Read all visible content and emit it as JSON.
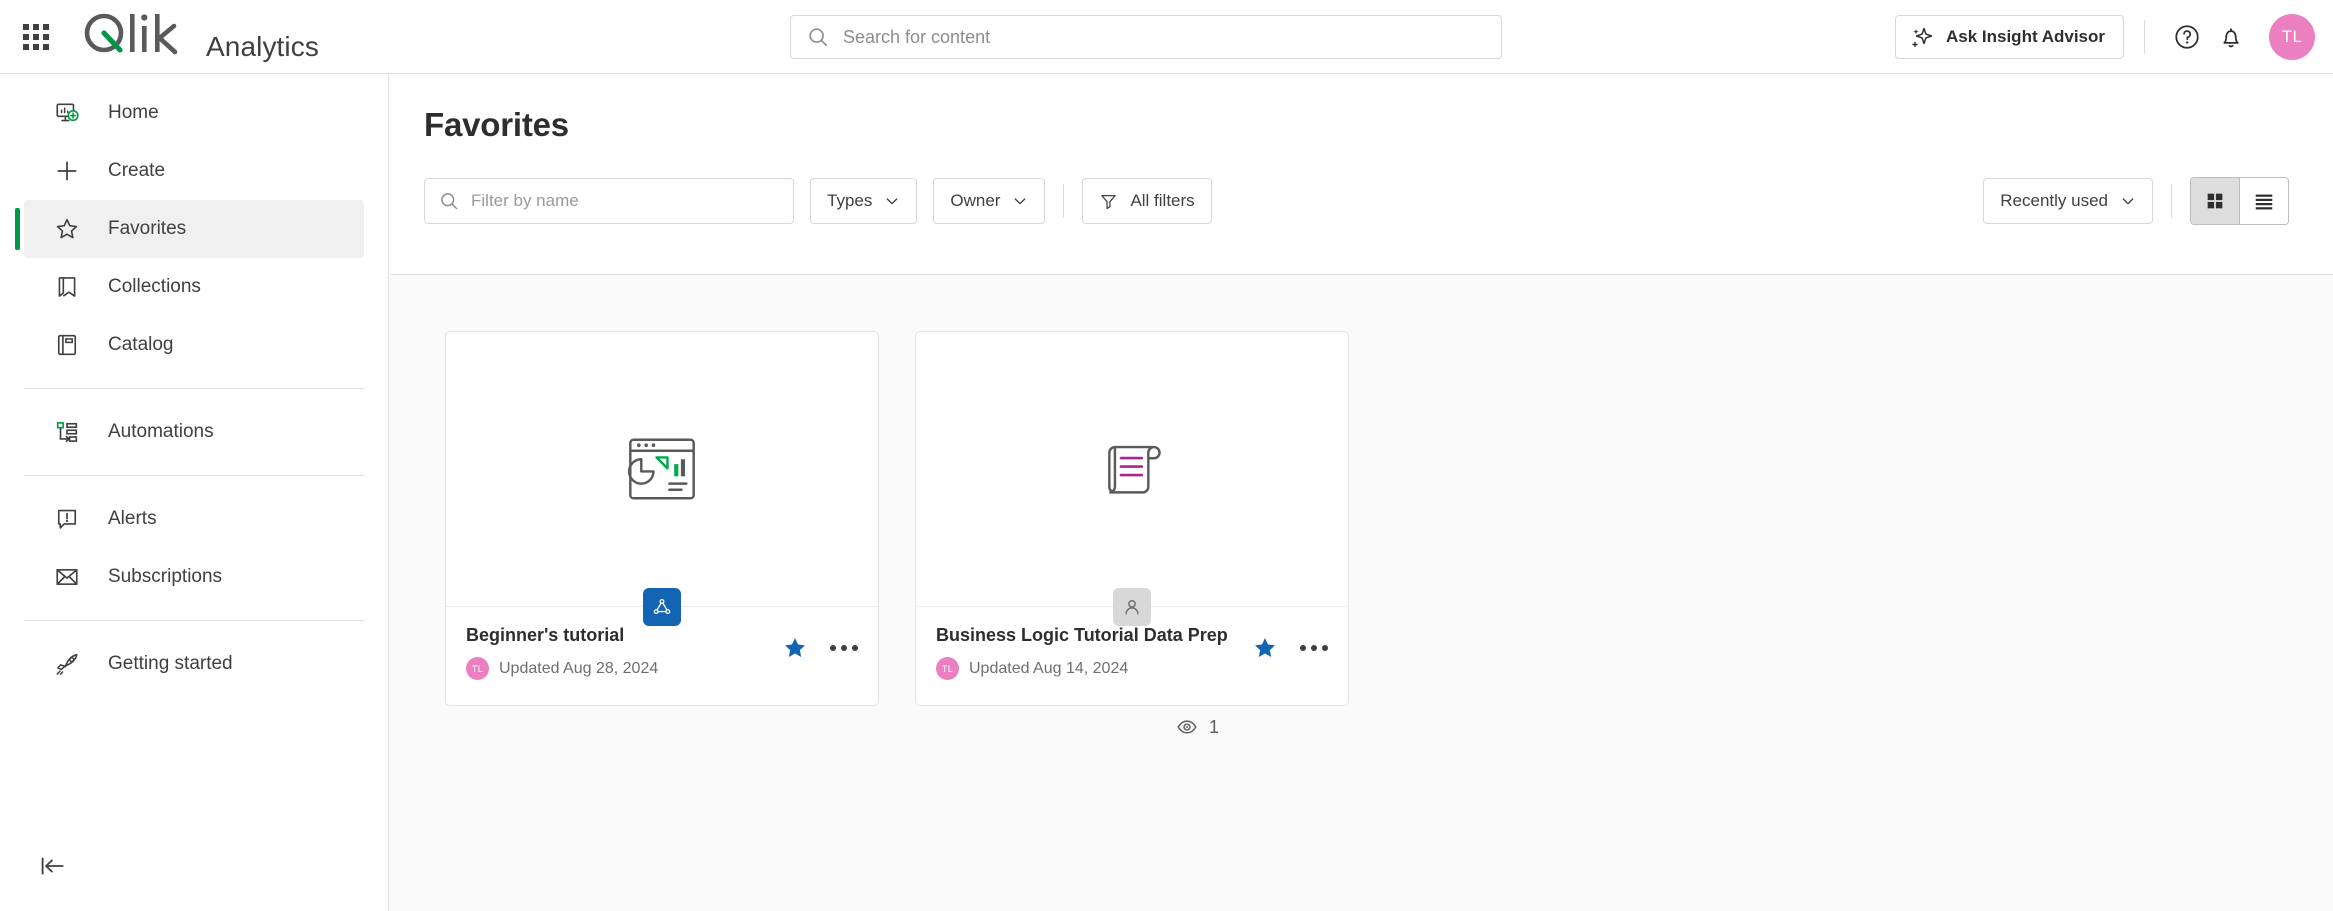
{
  "header": {
    "app_launcher_icon": "grid-apps-icon",
    "logo_text": "Qlik",
    "product_name": "Analytics",
    "search": {
      "value": "",
      "placeholder": "Search for content",
      "icon": "search-icon"
    },
    "insight_advisor_label": "Ask Insight Advisor",
    "insight_advisor_icon": "sparkle-icon",
    "help_icon": "help-circle-icon",
    "notifications_icon": "bell-icon",
    "avatar_initials": "TL",
    "avatar_color": "#ec7fbf"
  },
  "sidebar": {
    "items": [
      {
        "label": "Home",
        "icon": "home-dashboard-icon",
        "active": false
      },
      {
        "label": "Create",
        "icon": "plus-icon",
        "active": false
      },
      {
        "label": "Favorites",
        "icon": "star-outline-icon",
        "active": true
      },
      {
        "label": "Collections",
        "icon": "bookmark-icon",
        "active": false
      },
      {
        "label": "Catalog",
        "icon": "book-icon",
        "active": false
      },
      {
        "label": "Automations",
        "icon": "automation-flow-icon",
        "active": false
      },
      {
        "label": "Alerts",
        "icon": "alert-bubble-icon",
        "active": false
      },
      {
        "label": "Subscriptions",
        "icon": "envelope-icon",
        "active": false
      },
      {
        "label": "Getting started",
        "icon": "rocket-icon",
        "active": false
      }
    ],
    "collapse_icon": "collapse-left-icon",
    "active_accent_color": "#009845"
  },
  "main": {
    "page_title": "Favorites",
    "toolbar": {
      "filter_input": {
        "value": "",
        "placeholder": "Filter by name",
        "icon": "search-icon"
      },
      "types_label": "Types",
      "owner_label": "Owner",
      "all_filters_label": "All filters",
      "all_filters_icon": "funnel-icon",
      "chevron_icon": "chevron-down-icon",
      "sort_label": "Recently used",
      "grid_view_icon": "grid-view-icon",
      "list_view_icon": "list-view-icon",
      "active_view": "grid"
    },
    "cards": [
      {
        "name": "Beginner's tutorial",
        "thumb_icon": "app-chart-window-icon",
        "badge_icon": "qlik-app-icon",
        "badge_style": "blue",
        "owner_initials": "TL",
        "updated": "Updated Aug 28, 2024",
        "favorited": true,
        "star_icon": "star-filled-icon",
        "more_icon": "more-horizontal-icon"
      },
      {
        "name": "Business Logic Tutorial Data Prep",
        "thumb_icon": "script-scroll-icon",
        "badge_icon": "person-icon",
        "badge_style": "gray",
        "owner_initials": "TL",
        "updated": "Updated Aug 14, 2024",
        "favorited": true,
        "star_icon": "star-filled-icon",
        "more_icon": "more-horizontal-icon"
      }
    ],
    "view_count": {
      "icon": "eye-icon",
      "value": "1"
    }
  }
}
